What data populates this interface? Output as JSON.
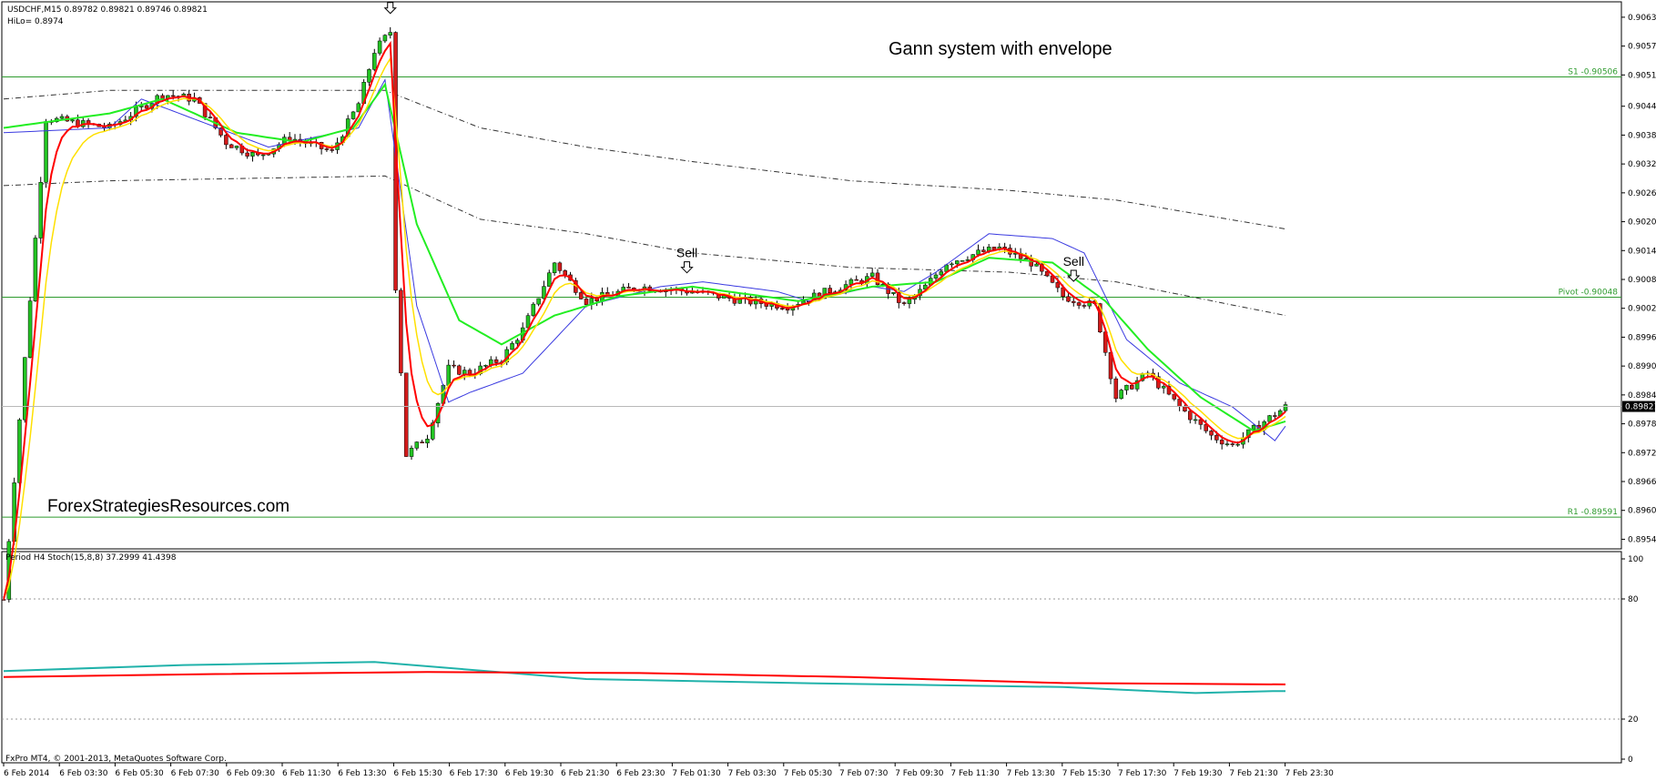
{
  "header": {
    "symbol_line": "USDCHF,M15  0.89782 0.89821 0.89746 0.89821",
    "hilo_line": "HiLo= 0.8974"
  },
  "title": "Gann system with envelope",
  "watermark": "ForexStrategiesResources.com",
  "footer": "FxPro MT4, © 2001-2013, MetaQuotes Software Corp.",
  "colors": {
    "bull": "#22c322",
    "bear": "#d41b1b",
    "ma_fast": "#ff0000",
    "ma_mid": "#ffe000",
    "ma_slow": "#22ee22",
    "hilo": "#3a3ae0",
    "envelope": "#333333",
    "level_line": "#2e9b2e",
    "stoch_main": "#20b2aa",
    "stoch_signal": "#ff0000"
  },
  "price_axis": {
    "ticks": [
      "0.90630",
      "0.90570",
      "0.90510",
      "0.90445",
      "0.90385",
      "0.90325",
      "0.90265",
      "0.90205",
      "0.90145",
      "0.90085",
      "0.90025",
      "0.89965",
      "0.89905",
      "0.89845",
      "0.89785",
      "0.89725",
      "0.89665",
      "0.89605",
      "0.89545"
    ],
    "current_price": "0.89821"
  },
  "levels": [
    {
      "label": "S1 -0.90506",
      "price": 0.90506
    },
    {
      "label": "Pivot -0.90048",
      "price": 0.90048
    },
    {
      "label": "R1 -0.89591",
      "price": 0.89591
    }
  ],
  "signals": [
    {
      "label": "Sell",
      "time_index": 73
    },
    {
      "label": "Sell",
      "time_index": 129
    },
    {
      "label": "Sell",
      "time_index": 202
    }
  ],
  "time_axis": {
    "labels": [
      "6 Feb 2014",
      "6 Feb 03:30",
      "6 Feb 05:30",
      "6 Feb 07:30",
      "6 Feb 09:30",
      "6 Feb 11:30",
      "6 Feb 13:30",
      "6 Feb 15:30",
      "6 Feb 17:30",
      "6 Feb 19:30",
      "6 Feb 21:30",
      "6 Feb 23:30",
      "7 Feb 01:30",
      "7 Feb 03:30",
      "7 Feb 05:30",
      "7 Feb 07:30",
      "7 Feb 09:30",
      "7 Feb 11:30",
      "7 Feb 13:30",
      "7 Feb 15:30",
      "7 Feb 17:30",
      "7 Feb 19:30",
      "7 Feb 21:30",
      "7 Feb 23:30"
    ]
  },
  "stoch_panel": {
    "label": "Period H4 Stoch(15,8,8) 37.2999 41.4398",
    "ticks": [
      "100",
      "80",
      "20",
      "0"
    ],
    "main": [
      [
        0,
        44
      ],
      [
        34,
        47
      ],
      [
        70,
        48.5
      ],
      [
        110,
        40
      ],
      [
        150,
        38
      ],
      [
        200,
        36
      ],
      [
        225,
        33
      ],
      [
        240,
        34
      ],
      [
        242,
        34
      ]
    ],
    "signal": [
      [
        0,
        41
      ],
      [
        40,
        42.5
      ],
      [
        80,
        43.5
      ],
      [
        120,
        43
      ],
      [
        160,
        41
      ],
      [
        200,
        38
      ],
      [
        242,
        37.3
      ]
    ]
  },
  "chart_data": {
    "type": "candlestick",
    "symbol": "USDCHF",
    "timeframe": "M15",
    "ylim": [
      0.89525,
      0.90662
    ],
    "candles_count": 243,
    "price_path": [
      [
        0,
        0.8942
      ],
      [
        8,
        0.9042
      ],
      [
        20,
        0.904
      ],
      [
        30,
        0.9047
      ],
      [
        36,
        0.9046
      ],
      [
        42,
        0.9037
      ],
      [
        48,
        0.9034
      ],
      [
        54,
        0.9038
      ],
      [
        62,
        0.9035
      ],
      [
        67,
        0.9045
      ],
      [
        70,
        0.9056
      ],
      [
        73,
        0.906
      ],
      [
        74,
        0.9007
      ],
      [
        76,
        0.8972
      ],
      [
        80,
        0.8976
      ],
      [
        84,
        0.899
      ],
      [
        88,
        0.8989
      ],
      [
        94,
        0.8992
      ],
      [
        98,
        0.8998
      ],
      [
        104,
        0.9012
      ],
      [
        110,
        0.9004
      ],
      [
        120,
        0.9007
      ],
      [
        130,
        0.9006
      ],
      [
        140,
        0.9004
      ],
      [
        148,
        0.9003
      ],
      [
        158,
        0.9007
      ],
      [
        164,
        0.9009
      ],
      [
        170,
        0.9003
      ],
      [
        174,
        0.9007
      ],
      [
        178,
        0.9012
      ],
      [
        184,
        0.9014
      ],
      [
        188,
        0.9015
      ],
      [
        194,
        0.9012
      ],
      [
        200,
        0.9005
      ],
      [
        206,
        0.9003
      ],
      [
        210,
        0.8984
      ],
      [
        216,
        0.8989
      ],
      [
        222,
        0.8982
      ],
      [
        228,
        0.8976
      ],
      [
        232,
        0.8974
      ],
      [
        238,
        0.8979
      ],
      [
        242,
        0.8982
      ]
    ],
    "hilo_path": [
      [
        0,
        0.9039
      ],
      [
        20,
        0.904
      ],
      [
        26,
        0.9046
      ],
      [
        50,
        0.9036
      ],
      [
        67,
        0.904
      ],
      [
        72,
        0.905
      ],
      [
        78,
        0.9003
      ],
      [
        84,
        0.8983
      ],
      [
        88,
        0.8985
      ],
      [
        98,
        0.8989
      ],
      [
        110,
        0.9003
      ],
      [
        124,
        0.9007
      ],
      [
        132,
        0.9008
      ],
      [
        146,
        0.9006
      ],
      [
        152,
        0.9004
      ],
      [
        164,
        0.9007
      ],
      [
        170,
        0.9006
      ],
      [
        176,
        0.901
      ],
      [
        186,
        0.9018
      ],
      [
        198,
        0.9017
      ],
      [
        204,
        0.9014
      ],
      [
        212,
        0.8996
      ],
      [
        222,
        0.8987
      ],
      [
        232,
        0.8982
      ],
      [
        240,
        0.8975
      ],
      [
        242,
        0.8978
      ]
    ],
    "envelope_upper": [
      [
        0,
        0.9046
      ],
      [
        20,
        0.90478
      ],
      [
        72,
        0.90478
      ],
      [
        90,
        0.904
      ],
      [
        110,
        0.9036
      ],
      [
        130,
        0.9033
      ],
      [
        160,
        0.9029
      ],
      [
        190,
        0.9027
      ],
      [
        210,
        0.9025
      ],
      [
        242,
        0.9019
      ]
    ],
    "envelope_lower": [
      [
        0,
        0.9028
      ],
      [
        20,
        0.9029
      ],
      [
        72,
        0.903
      ],
      [
        90,
        0.9021
      ],
      [
        110,
        0.9018
      ],
      [
        130,
        0.9014
      ],
      [
        160,
        0.9011
      ],
      [
        190,
        0.901
      ],
      [
        210,
        0.9008
      ],
      [
        242,
        0.9001
      ]
    ],
    "ma_slow_path": [
      [
        0,
        0.904
      ],
      [
        20,
        0.9043
      ],
      [
        30,
        0.9046
      ],
      [
        44,
        0.9039
      ],
      [
        56,
        0.9037
      ],
      [
        66,
        0.904
      ],
      [
        72,
        0.9049
      ],
      [
        78,
        0.902
      ],
      [
        86,
        0.9
      ],
      [
        94,
        0.8995
      ],
      [
        104,
        0.9001
      ],
      [
        116,
        0.9005
      ],
      [
        130,
        0.9007
      ],
      [
        150,
        0.9004
      ],
      [
        164,
        0.9007
      ],
      [
        176,
        0.9008
      ],
      [
        186,
        0.9013
      ],
      [
        198,
        0.9012
      ],
      [
        208,
        0.9004
      ],
      [
        216,
        0.8994
      ],
      [
        226,
        0.8984
      ],
      [
        236,
        0.8977
      ],
      [
        242,
        0.8979
      ]
    ]
  }
}
